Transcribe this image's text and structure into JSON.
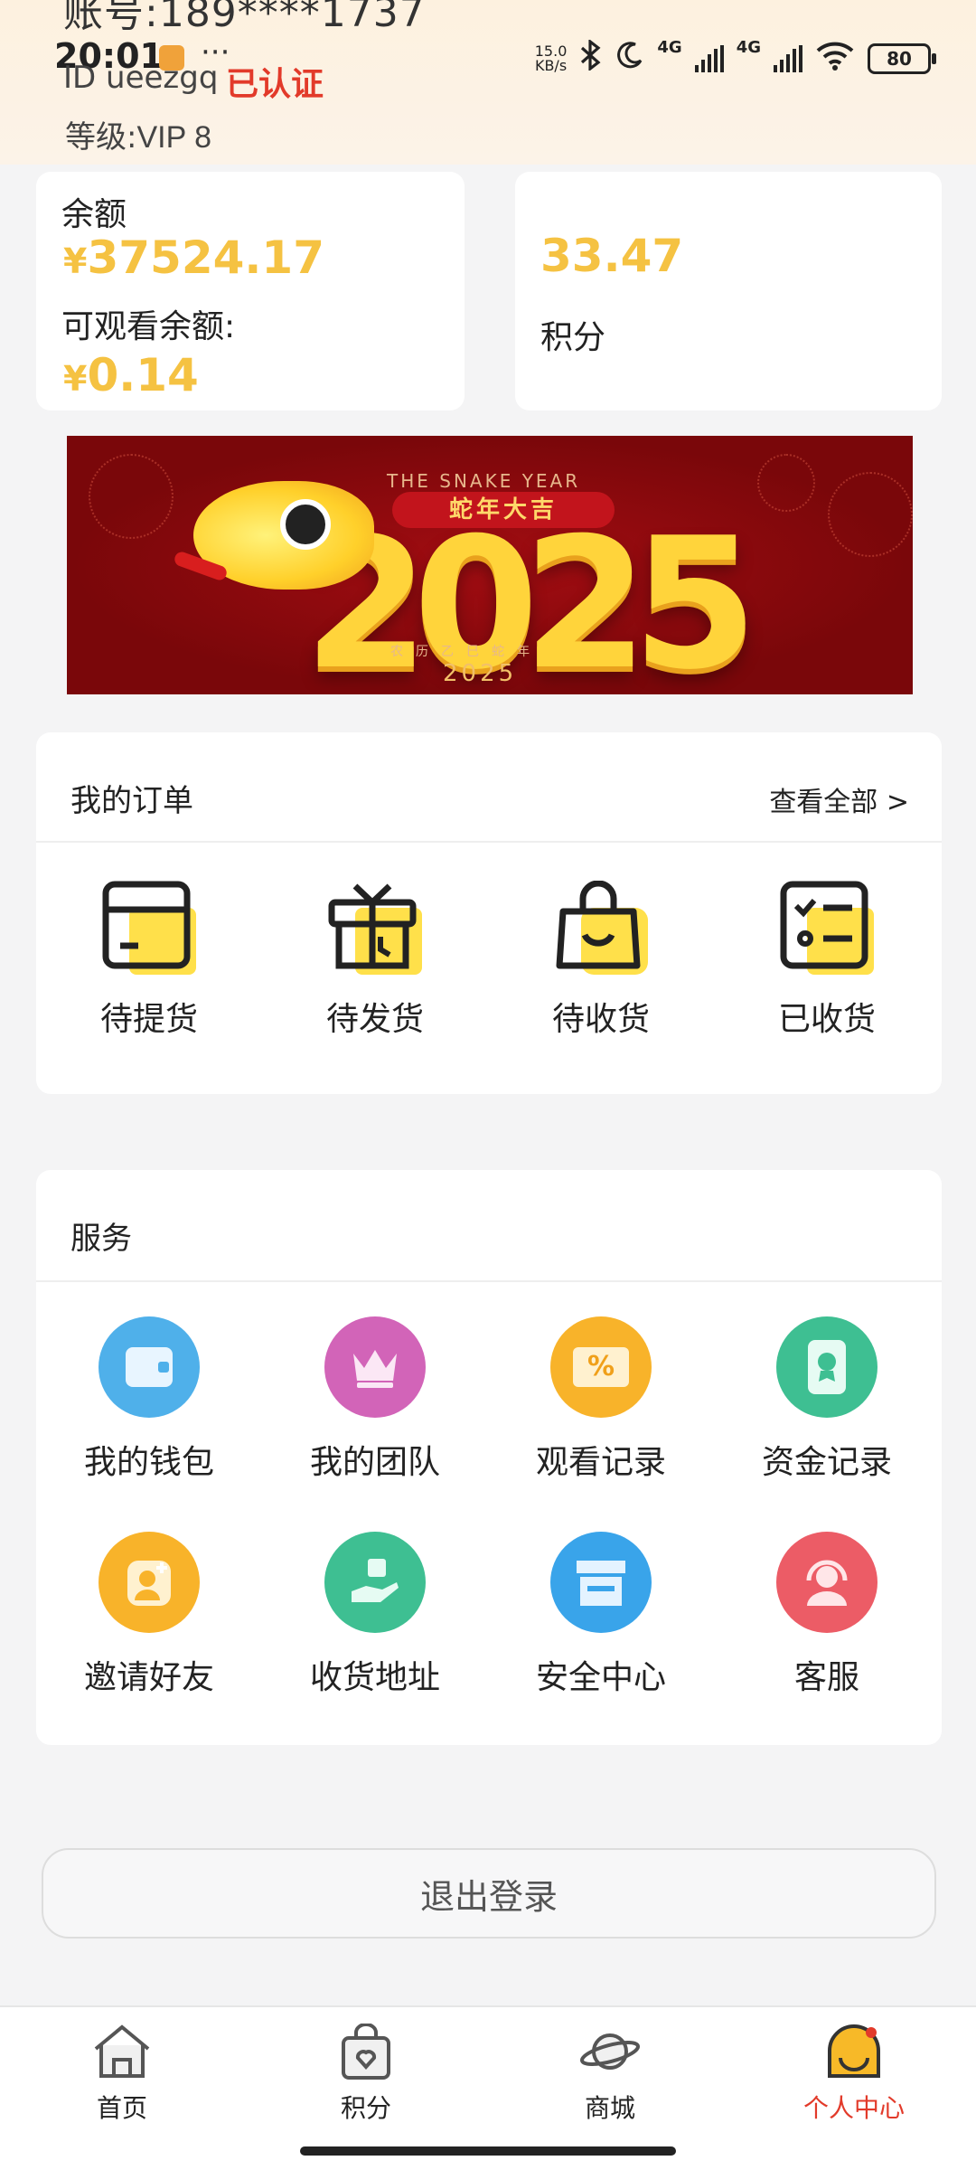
{
  "status_bar": {
    "time": "20:01",
    "more": "···",
    "net_speed_value": "15.0",
    "net_speed_unit": "KB/s",
    "network_1": "4G",
    "network_2": "4G",
    "battery": "80",
    "icons": [
      "bluetooth-icon",
      "moon-icon",
      "signal-icon",
      "wifi-icon",
      "battery-icon"
    ]
  },
  "profile": {
    "account": "账号:189****1737",
    "user_id": "ID ueezgq",
    "verified": "已认证",
    "level_label": "等级:",
    "level_value": "VIP 8"
  },
  "wallet": {
    "balance_label": "余额",
    "currency": "¥",
    "balance": "37524.17",
    "viewable_label": "可观看余额:",
    "viewable_balance": "0.14",
    "points_value": "33.47",
    "points_label": "积分"
  },
  "banner": {
    "top_text": "THE SNAKE YEAR",
    "blessing": "蛇年大吉",
    "big_number": "2025",
    "small_text": "农历乙巳蛇年",
    "year": "2025"
  },
  "orders": {
    "title": "我的订单",
    "view_all": "查看全部 >",
    "items": [
      {
        "label": "待提货",
        "icon": "card-icon"
      },
      {
        "label": "待发货",
        "icon": "gift-clock-icon"
      },
      {
        "label": "待收货",
        "icon": "shopping-bag-icon"
      },
      {
        "label": "已收货",
        "icon": "checklist-icon"
      }
    ]
  },
  "services": {
    "title": "服务",
    "items": [
      {
        "label": "我的钱包",
        "icon": "wallet-icon",
        "color": "#4fb0ea"
      },
      {
        "label": "我的团队",
        "icon": "crown-icon",
        "color": "#d264b8"
      },
      {
        "label": "观看记录",
        "icon": "coupon-icon",
        "color": "#f8b32a"
      },
      {
        "label": "资金记录",
        "icon": "phone-medal-icon",
        "color": "#3ebf92"
      },
      {
        "label": "邀请好友",
        "icon": "add-friend-icon",
        "color": "#f8b32a"
      },
      {
        "label": "收货地址",
        "icon": "hand-box-icon",
        "color": "#3ebf92"
      },
      {
        "label": "安全中心",
        "icon": "store-icon",
        "color": "#39a4ea"
      },
      {
        "label": "客服",
        "icon": "headset-icon",
        "color": "#ec5c66"
      }
    ],
    "percent_symbol": "%"
  },
  "logout": {
    "label": "退出登录"
  },
  "tabbar": {
    "items": [
      {
        "label": "首页",
        "icon": "home-icon"
      },
      {
        "label": "积分",
        "icon": "points-bag-icon"
      },
      {
        "label": "商城",
        "icon": "planet-icon"
      },
      {
        "label": "个人中心",
        "icon": "profile-icon",
        "active": true
      }
    ],
    "active_color": "#e23a2a"
  },
  "colors": {
    "accent_yellow": "#f5c242",
    "verified_red": "#e23a2a",
    "page_bg": "#f4f4f5"
  }
}
